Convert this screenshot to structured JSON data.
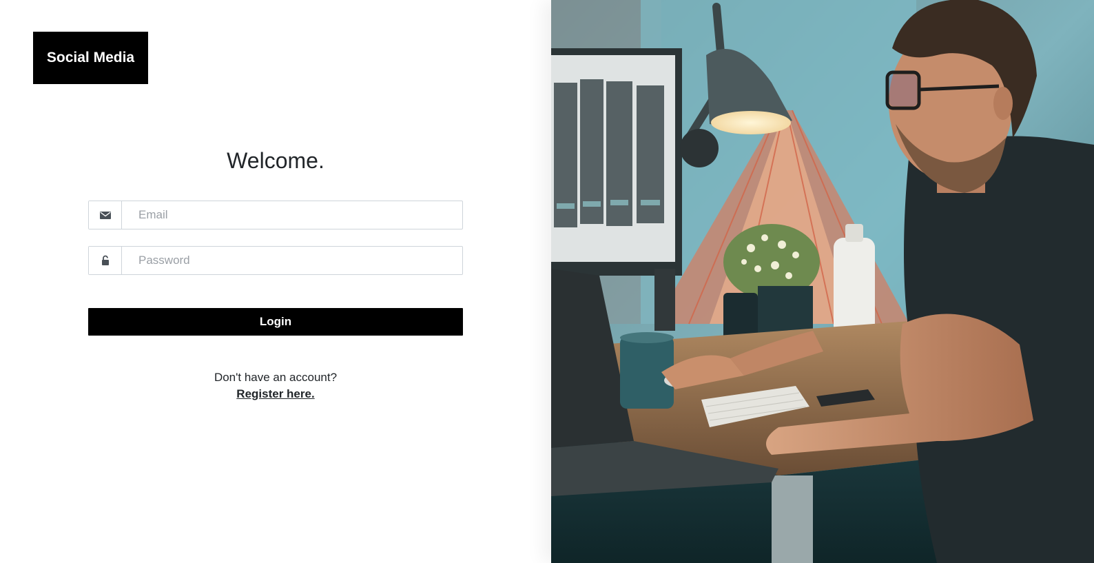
{
  "brand": {
    "logo_text": "Social Media"
  },
  "login": {
    "heading": "Welcome.",
    "email": {
      "placeholder": "Email",
      "icon": "envelope-icon"
    },
    "password": {
      "placeholder": "Password",
      "icon": "lock-icon"
    },
    "submit_label": "Login"
  },
  "register": {
    "prompt": "Don't have an account?",
    "link_label": "Register here."
  },
  "hero": {
    "subject": "photo"
  },
  "colors": {
    "primary": "#000000",
    "background": "#ffffff",
    "text": "#212529",
    "border": "#ced4da"
  }
}
